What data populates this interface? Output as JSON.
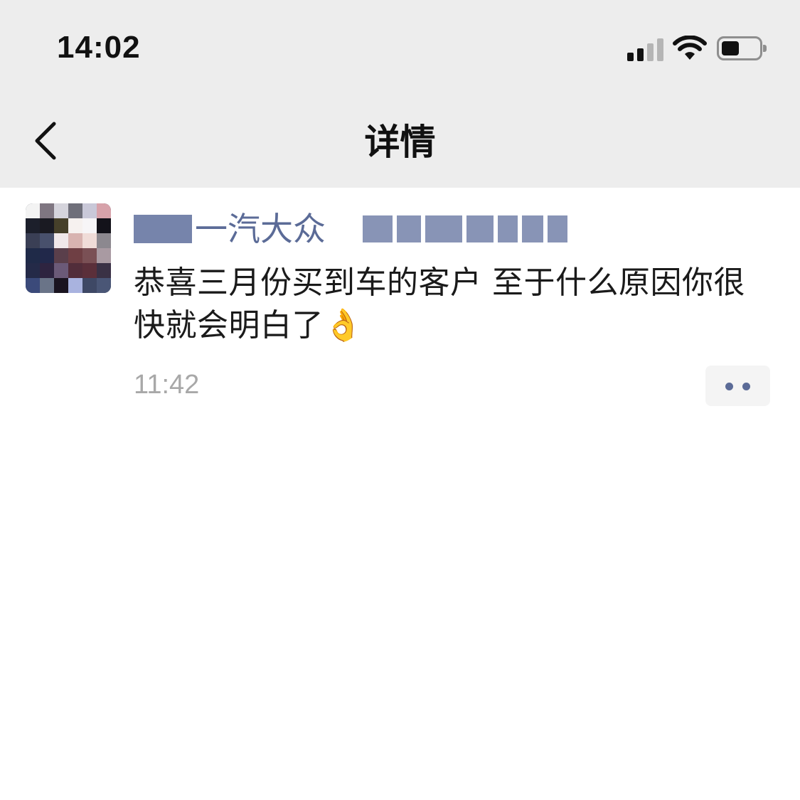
{
  "status_bar": {
    "time": "14:02",
    "icons": [
      "cellular-signal-icon",
      "wifi-icon",
      "battery-icon"
    ],
    "battery_level": 0.4
  },
  "nav": {
    "title": "详情",
    "back_icon": "chevron-left-icon"
  },
  "post": {
    "author_visible_name": "一汽大众",
    "message": "恭喜三月份买到车的客户 至于什么原因你很快就会明白了👌",
    "timestamp": "11:42",
    "more_icon": "more-dots-icon"
  },
  "colors": {
    "topbar_bg": "#ededed",
    "name_color": "#5b6b97",
    "text_color": "#1a1a1a",
    "timestamp_color": "#a8a8a8"
  }
}
